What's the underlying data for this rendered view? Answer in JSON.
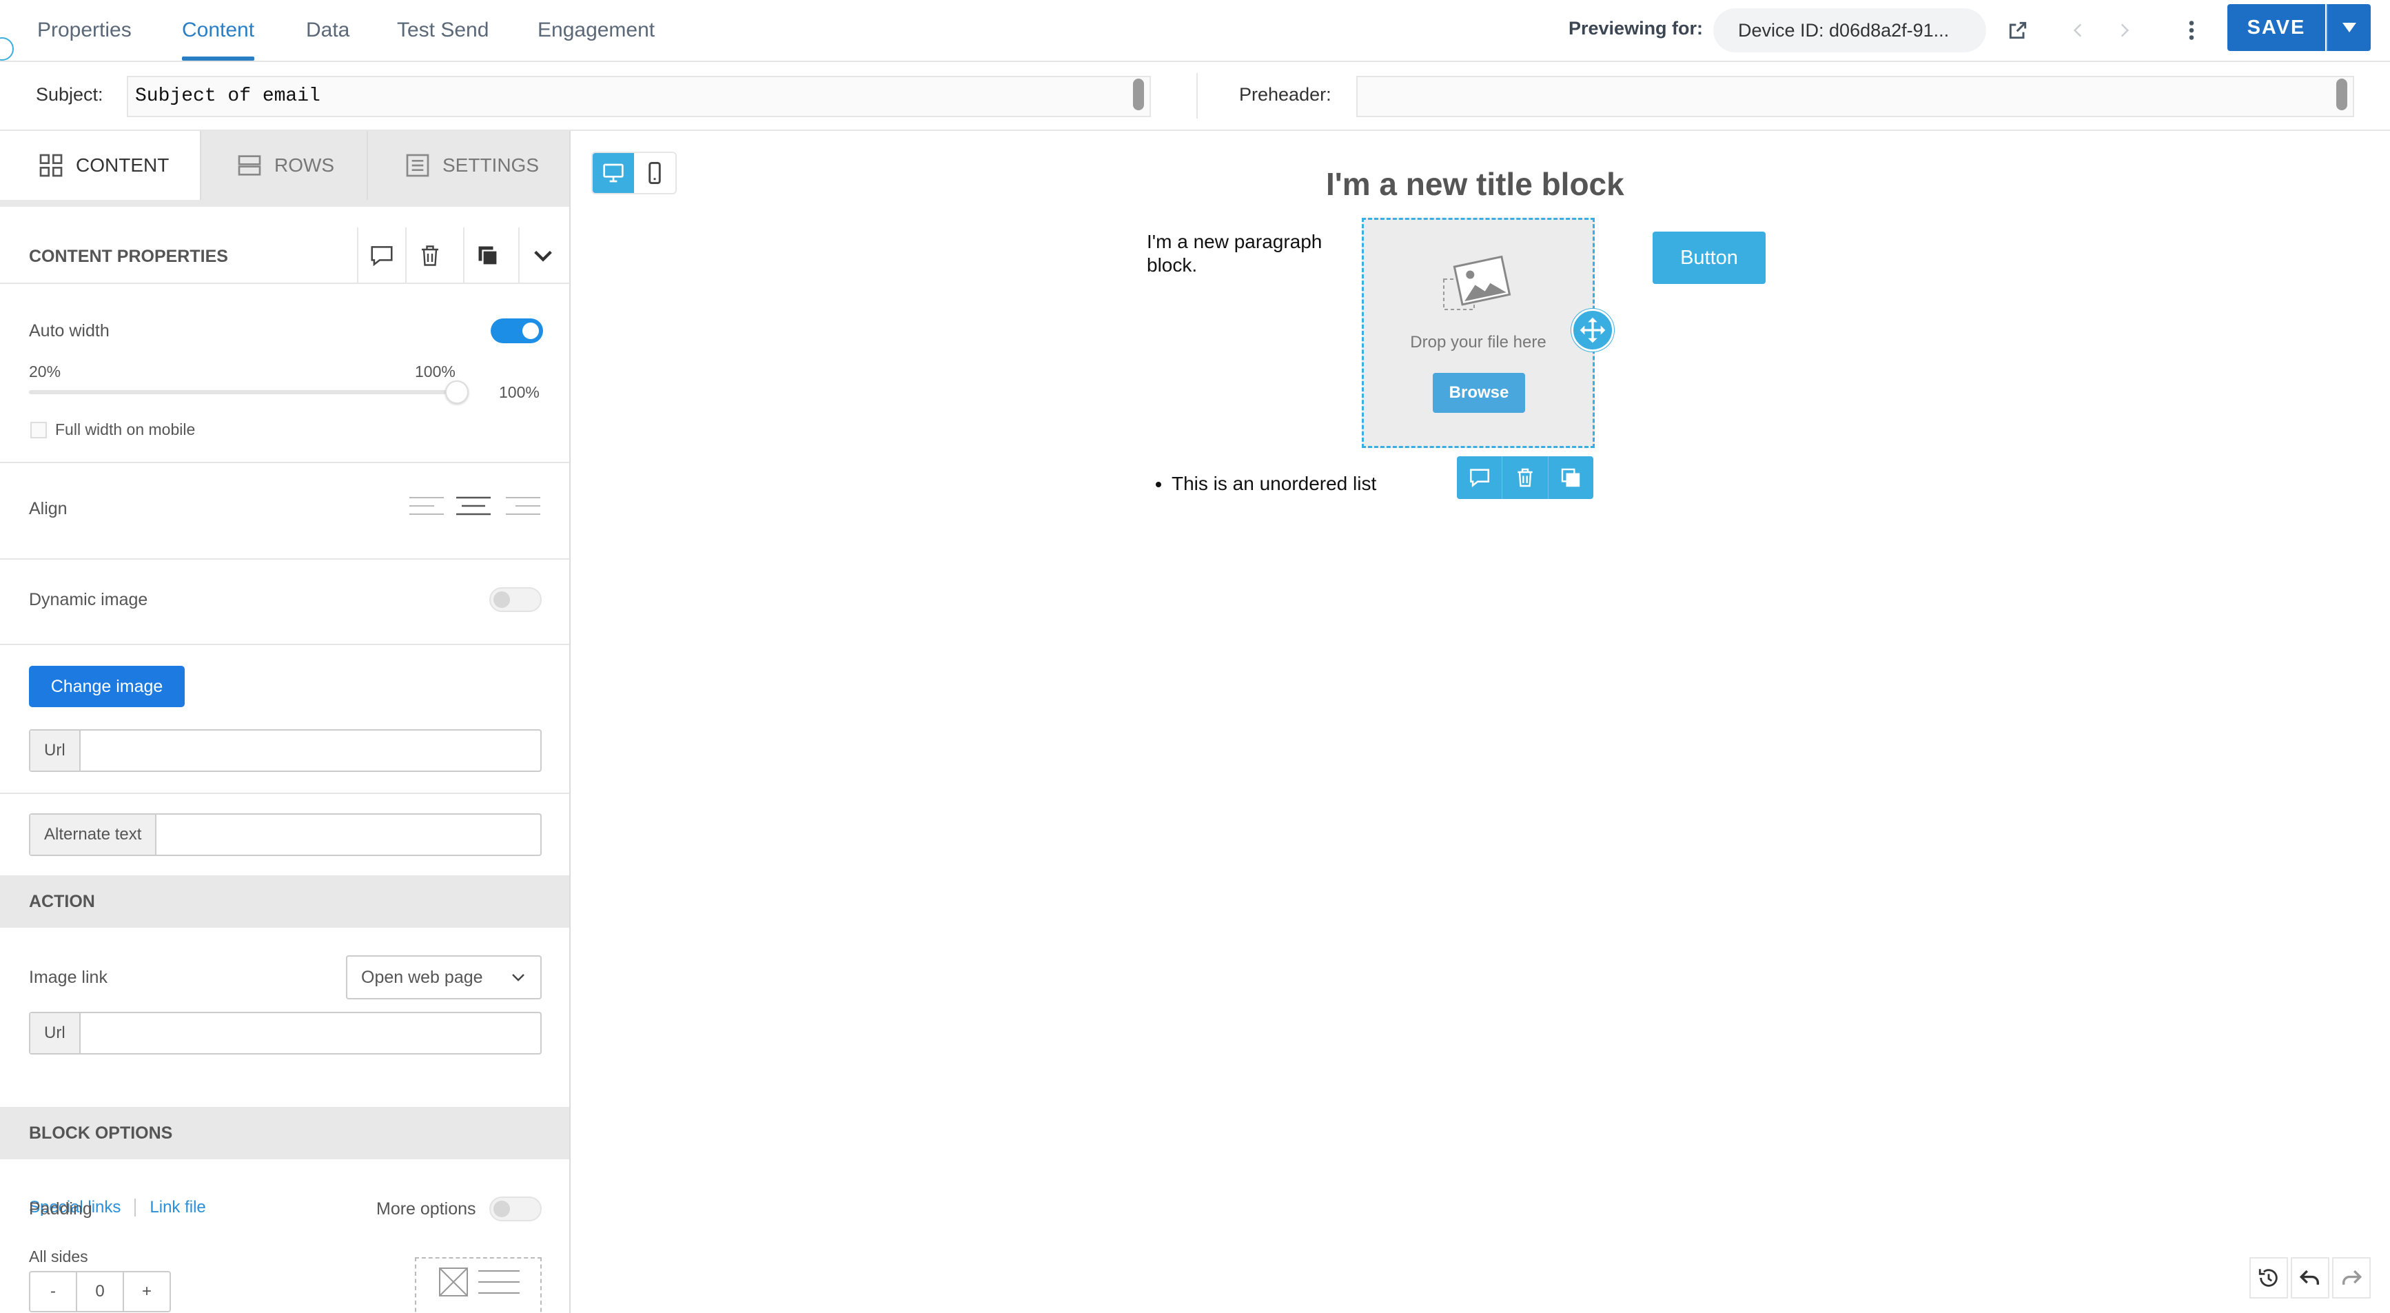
{
  "top_nav": {
    "tabs": [
      {
        "label": "Properties"
      },
      {
        "label": "Content"
      },
      {
        "label": "Data"
      },
      {
        "label": "Test Send"
      },
      {
        "label": "Engagement"
      }
    ],
    "active_tab": "Content",
    "previewing_label": "Previewing for:",
    "device_pill": "Device ID: d06d8a2f-91...",
    "save_label": "SAVE",
    "icons": [
      "external-link-icon",
      "chevron-left-icon",
      "chevron-right-icon",
      "kebab-menu-icon",
      "caret-down-icon"
    ]
  },
  "subject_row": {
    "subject_label": "Subject:",
    "subject_value": "Subject of email",
    "preheader_label": "Preheader:",
    "preheader_value": ""
  },
  "left_panel": {
    "tabs": [
      {
        "label": "CONTENT",
        "icon": "grid-icon"
      },
      {
        "label": "ROWS",
        "icon": "rows-icon"
      },
      {
        "label": "SETTINGS",
        "icon": "settings-list-icon"
      }
    ],
    "content_properties": {
      "title": "CONTENT PROPERTIES",
      "icons": [
        "comment-icon",
        "trash-icon",
        "duplicate-icon",
        "collapse-chevron-icon"
      ]
    },
    "auto_width": {
      "label": "Auto width",
      "enabled": true
    },
    "width_slider": {
      "min_label": "20%",
      "max_label": "100%",
      "value_label": "100%",
      "value_percent": 100
    },
    "full_width_mobile": {
      "label": "Full width on mobile",
      "checked": false
    },
    "align": {
      "label": "Align",
      "options": [
        "align-left-icon",
        "align-center-icon",
        "align-right-icon"
      ],
      "selected": "center"
    },
    "dynamic_image": {
      "label": "Dynamic image",
      "enabled": false
    },
    "change_image_label": "Change image",
    "url_field": {
      "addon": "Url",
      "value": ""
    },
    "alt_text_field": {
      "addon": "Alternate text",
      "value": ""
    },
    "action": {
      "section_title": "ACTION",
      "image_link_label": "Image link",
      "image_link_selected": "Open web page",
      "url_field": {
        "addon": "Url",
        "value": ""
      },
      "special_links_label": "Special links",
      "link_file_label": "Link file"
    },
    "block_options": {
      "section_title": "BLOCK OPTIONS",
      "padding_label": "Padding",
      "more_options_label": "More options",
      "more_options_enabled": false,
      "all_sides_label": "All sides",
      "stepper": {
        "minus": "-",
        "value": "0",
        "plus": "+"
      }
    }
  },
  "canvas": {
    "view_modes": [
      "desktop-icon",
      "mobile-icon"
    ],
    "active_view": "desktop",
    "title_block": "I'm a new title block",
    "paragraph_block": "I'm a new paragraph block.",
    "image_block": {
      "drop_text": "Drop your file here",
      "browse_label": "Browse"
    },
    "button_block": "Button",
    "list_items": [
      "This is an unordered list"
    ],
    "block_toolbar_icons": [
      "comment-icon",
      "trash-icon",
      "duplicate-icon"
    ],
    "history_icons": [
      "history-icon",
      "undo-icon",
      "redo-icon"
    ]
  },
  "colors": {
    "accent": "#2a7fc4",
    "save": "#1c6fc4",
    "toggle_on": "#1c8ee6",
    "canvas_selection": "#3aaee0",
    "link": "#2a8fd8"
  }
}
